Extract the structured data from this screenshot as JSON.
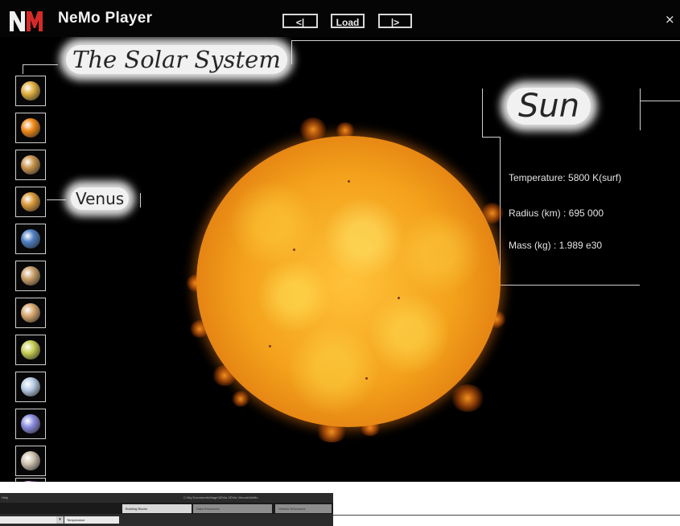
{
  "app": {
    "name": "NeMo Player",
    "logo_text": "NM",
    "close_glyph": "×"
  },
  "toolbar": {
    "prev_label": "<|",
    "load_label": "Load",
    "next_label": "|>"
  },
  "scene": {
    "title": "The Solar System",
    "hover_label": "Venus",
    "selected_body": "Sun",
    "info": {
      "temperature": "Temperature: 5800 K(surf)",
      "radius": "Radius (km) : 695 000",
      "mass": "Mass (kg) : 1.989 e30"
    }
  },
  "planet_list": [
    {
      "name": "solar-system",
      "color": "#e0b040"
    },
    {
      "name": "sun",
      "color": "#f08a18"
    },
    {
      "name": "mercury",
      "color": "#c9954e"
    },
    {
      "name": "venus",
      "color": "#d99a3a"
    },
    {
      "name": "earth",
      "color": "#4f7fc2"
    },
    {
      "name": "mars",
      "color": "#caa06a"
    },
    {
      "name": "jupiter",
      "color": "#d8a870"
    },
    {
      "name": "saturn",
      "color": "#c8cf55"
    },
    {
      "name": "uranus",
      "color": "#b9cde6"
    },
    {
      "name": "neptune",
      "color": "#8c8ee0"
    },
    {
      "name": "pluto",
      "color": "#cfc2ae"
    },
    {
      "name": "nebula",
      "color": "#7a3fa0"
    }
  ],
  "background_window": {
    "menu_item": "Help",
    "path_text": "C:\\My Documents\\Nage\\3DVia 3DVia Virtools\\NeMo",
    "tabs": [
      "Building Blocks",
      "Data Resources",
      "Virtools Resources"
    ],
    "field1": "",
    "field2": "Temperature"
  },
  "colors": {
    "background": "#000000",
    "sun_core": "#ffc23a",
    "sun_edge": "#b95008",
    "label_glow": "#f1f1f1",
    "logo_red": "#d62a2a"
  }
}
